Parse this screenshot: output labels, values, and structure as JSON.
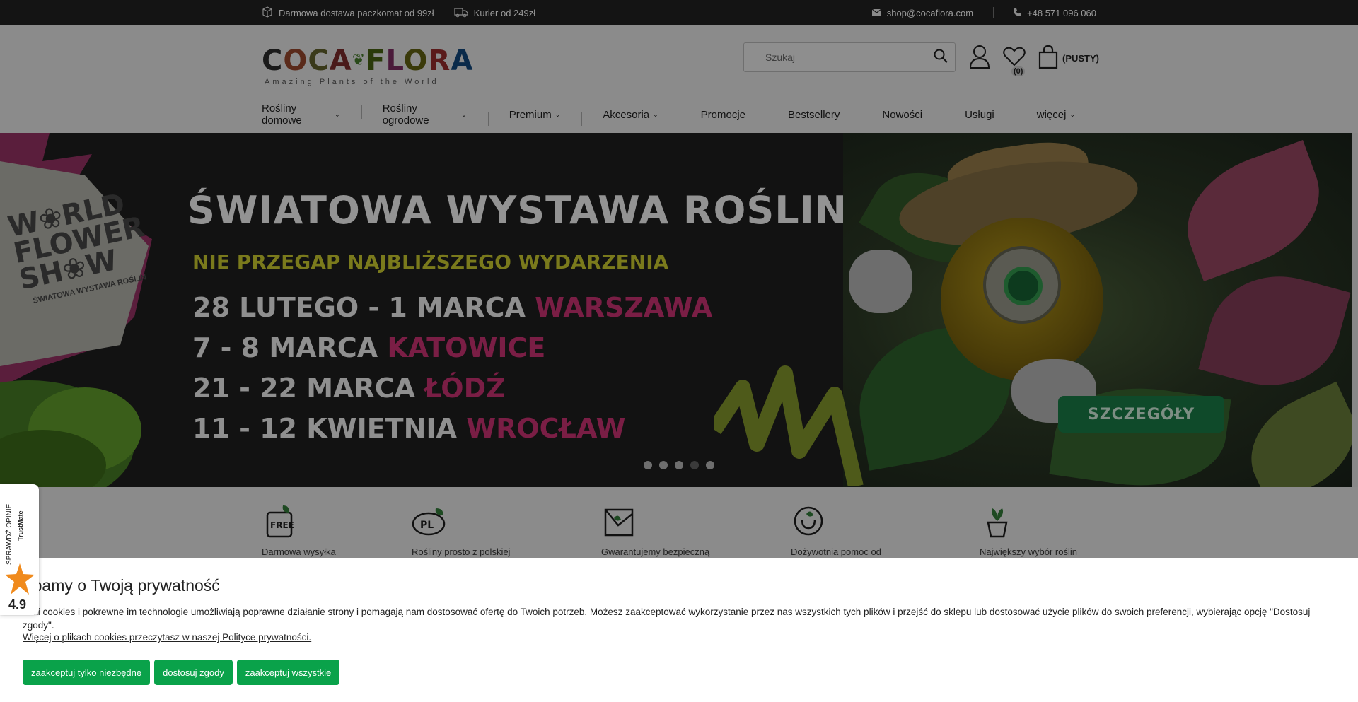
{
  "topbar": {
    "shipping_parcel": "Darmowa dostawa paczkomat od 99zł",
    "shipping_courier": "Kurier od 249zł",
    "email": "shop@cocaflora.com",
    "phone": "+48 571 096 060"
  },
  "header": {
    "logo_text": "COCA FLORA",
    "logo_tagline": "Amazing Plants of the World",
    "search_placeholder": "Szukaj",
    "wishlist_count": "(0)",
    "cart_label": "(PUSTY)"
  },
  "nav": {
    "items": [
      {
        "label": "Rośliny domowe",
        "dropdown": true
      },
      {
        "label": "Rośliny ogrodowe",
        "dropdown": true
      },
      {
        "label": "Premium",
        "dropdown": true
      },
      {
        "label": "Akcesoria",
        "dropdown": true
      },
      {
        "label": "Promocje",
        "dropdown": false
      },
      {
        "label": "Bestsellery",
        "dropdown": false
      },
      {
        "label": "Nowości",
        "dropdown": false
      },
      {
        "label": "Usługi",
        "dropdown": false
      },
      {
        "label": "więcej",
        "dropdown": true
      }
    ]
  },
  "banner": {
    "badge_line1": "W❀RLD",
    "badge_line2": "FLOWER",
    "badge_line3": "SH❀W",
    "badge_sub": "ŚWIATOWA WYSTAWA ROŚLIN",
    "title": "ŚWIATOWA WYSTAWA ROŚLIN",
    "subtitle": "NIE PRZEGAP NAJBLIŻSZEGO WYDARZENIA",
    "events": [
      {
        "date": "28 LUTEGO - 1 MARCA",
        "city": "WARSZAWA"
      },
      {
        "date": "7 - 8 MARCA",
        "city": "KATOWICE"
      },
      {
        "date": "21 - 22 MARCA",
        "city": "ŁÓDŹ"
      },
      {
        "date": "11 - 12 KWIETNIA",
        "city": "WROCŁAW"
      }
    ],
    "cta": "SZCZEGÓŁY",
    "slides": 5,
    "active_slide": 4
  },
  "features": [
    {
      "label": "Darmowa wysyłka",
      "icon": "free-icon"
    },
    {
      "label": "Rośliny prosto z polskiej",
      "icon": "pl-icon"
    },
    {
      "label": "Gwarantujemy bezpieczną",
      "icon": "box-icon"
    },
    {
      "label": "Dożywotnia pomoc od",
      "icon": "support-icon"
    },
    {
      "label": "Największy wybór roślin",
      "icon": "plant-pot-icon"
    }
  ],
  "cookie": {
    "title": "Dbamy o Twoją prywatność",
    "body": "Pliki cookies i pokrewne im technologie umożliwiają poprawne działanie strony i pomagają nam dostosować ofertę do Twoich potrzeb. Możesz zaakceptować wykorzystanie przez nas wszystkich tych plików i przejść do sklepu lub dostosować użycie plików do swoich preferencji, wybierając opcję \"Dostosuj zgody\".",
    "link": "Więcej o plikach cookies przeczytasz w naszej Polityce prywatności.",
    "btn_necessary": "zaakceptuj tylko niezbędne",
    "btn_customize": "dostosuj zgody",
    "btn_all": "zaakceptuj wszystkie"
  },
  "trustmate": {
    "label": "SPRAWDŹ OPINIE",
    "brand": "TrustMate",
    "score": "4.9"
  },
  "colors": {
    "accent_green": "#0aa24a",
    "topbar_bg": "#141414"
  }
}
